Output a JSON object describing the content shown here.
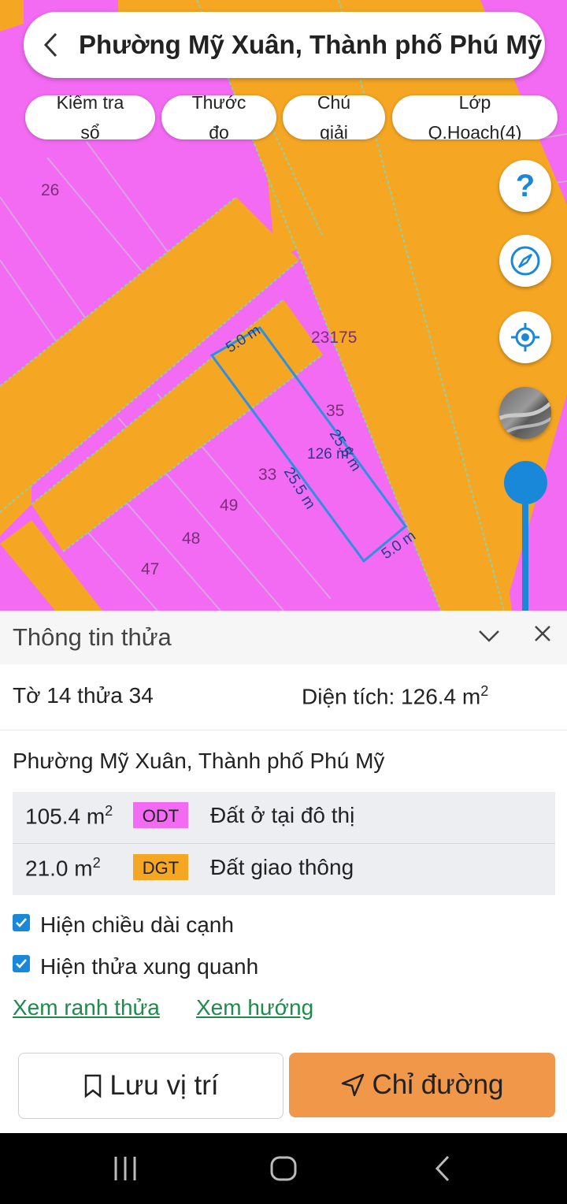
{
  "header": {
    "title": "Phường Mỹ Xuân, Thành phố Phú Mỹ"
  },
  "chips": [
    {
      "line1": "Kiểm tra",
      "line2": "sổ"
    },
    {
      "line1": "Thước",
      "line2": "đo"
    },
    {
      "line1": "Chú",
      "line2": "giải"
    },
    {
      "line1": "Lớp",
      "line2": "Q.Hoach(4)"
    }
  ],
  "map": {
    "help_label": "?",
    "lot_numbers": [
      "26",
      "23175",
      "35",
      "33",
      "49",
      "48",
      "47"
    ],
    "dimensions": {
      "top_edge": "5.0 m",
      "left_edge": "25.5 m",
      "right_edge": "25.5 m",
      "bottom_edge": "5.0 m",
      "area": "126 m²"
    }
  },
  "panel": {
    "title": "Thông tin thửa",
    "lot_label": "Tờ 14 thửa 34",
    "area_label": "Diện tích: 126.4 m",
    "area_sup": "2",
    "address": "Phường Mỹ Xuân, Thành phố Phú Mỹ",
    "land_uses": [
      {
        "amount": "105.4 m",
        "sup": "2",
        "code": "ODT",
        "code_color": "#f26bf2",
        "description": "Đất ở tại đô thị"
      },
      {
        "amount": "21.0 m",
        "sup": "2",
        "code": "DGT",
        "code_color": "#f5a623",
        "description": "Đất giao thông"
      }
    ],
    "options": [
      {
        "label": "Hiện chiều dài cạnh",
        "checked": true
      },
      {
        "label": "Hiện thửa xung quanh",
        "checked": true
      }
    ],
    "links": {
      "boundary": "Xem ranh thửa",
      "direction": "Xem hướng"
    },
    "buttons": {
      "save": "Lưu vị trí",
      "directions": "Chỉ đường"
    }
  },
  "colors": {
    "residential": "#f26bf2",
    "traffic": "#f5a623",
    "accent": "#1a88d8",
    "primary_button": "#f0974a",
    "link": "#1f8a4c"
  }
}
